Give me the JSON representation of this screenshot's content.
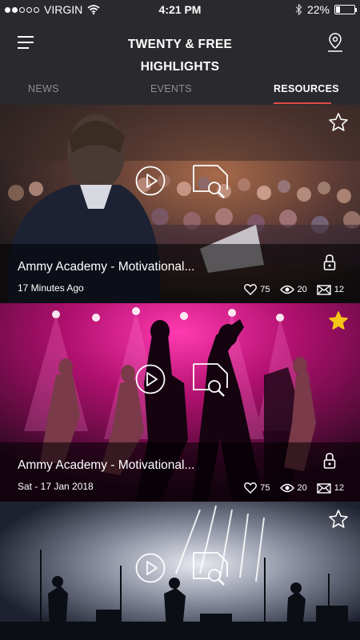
{
  "status_bar": {
    "carrier": "VIRGIN",
    "time": "4:21 PM",
    "battery": "22%",
    "battery_level": 0.22
  },
  "header": {
    "title_line1": "TWENTY & FREE",
    "title_line2": "HIGHLIGHTS"
  },
  "tabs": [
    {
      "label": "NEWS",
      "active": false
    },
    {
      "label": "EVENTS",
      "active": false
    },
    {
      "label": "RESOURCES",
      "active": true
    }
  ],
  "colors": {
    "accent": "#e24848",
    "star_active": "#f5c518",
    "background": "#2a2a2e"
  },
  "cards": [
    {
      "title": "Ammy Academy - Motivational...",
      "date": "17 Minutes Ago",
      "likes": "75",
      "views": "20",
      "messages": "12",
      "starred": false,
      "locked": true,
      "image": "conference-speaker"
    },
    {
      "title": "Ammy Academy - Motivational...",
      "date": "Sat - 17 Jan 2018",
      "likes": "75",
      "views": "20",
      "messages": "12",
      "starred": true,
      "locked": true,
      "image": "stage-dancers"
    },
    {
      "title": "",
      "date": "",
      "starred": false,
      "locked": false,
      "image": "concert-band"
    }
  ]
}
